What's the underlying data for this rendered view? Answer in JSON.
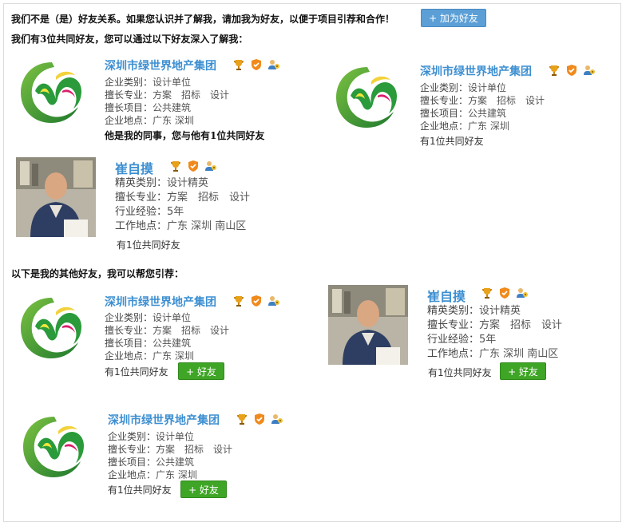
{
  "header": {
    "relation_text": "我们不是（是）好友关系。如果您认识并了解我，请加我为好友，以便于项目引荐和合作！",
    "add_friend_label": "+ 加为好友",
    "mutual_text": "我们有3位共同好友，您可以通过以下好友深入了解我："
  },
  "section2": {
    "title": "以下是我的其他好友，我可以帮您引荐："
  },
  "labels": {
    "company_type": "企业类别：",
    "specialty": "擅长专业：",
    "project": "擅长项目：",
    "company_location": "企业地点：",
    "elite_type": "精英类别：",
    "experience": "行业经验：",
    "work_location": "工作地点："
  },
  "company": {
    "name": "深圳市绿世界地产集团",
    "type": "设计单位",
    "specialty": "方案　招标　设计",
    "project": "公共建筑",
    "location": "广东  深圳"
  },
  "person": {
    "name": "崔自摸",
    "type": "设计精英",
    "specialty": "方案　招标　设计",
    "experience": "5年",
    "location": "广东  深圳  南山区"
  },
  "mutual": {
    "colleague": "他是我的同事，您与他有1位共同好友",
    "one_common": "有1位共同好友"
  },
  "buttons": {
    "add_friend": "+ 好友"
  },
  "icons": [
    "trophy-icon",
    "shield-icon",
    "user-icon"
  ],
  "colors": {
    "name_blue": "#3d8fd1",
    "green_button": "#3fa526",
    "top_button": "#5b9fd6"
  }
}
